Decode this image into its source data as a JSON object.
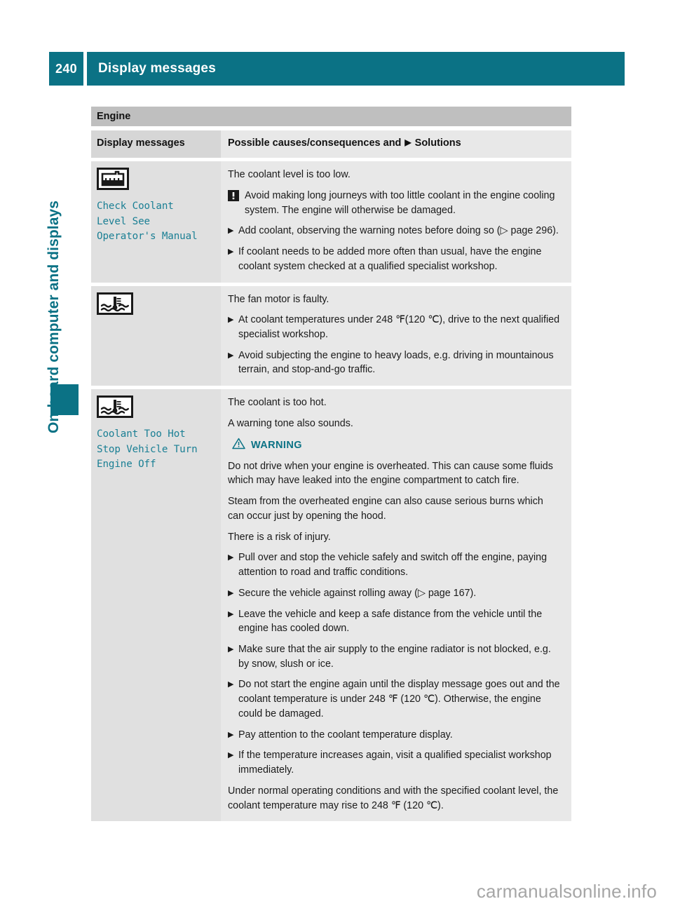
{
  "header": {
    "page_number": "240",
    "title": "Display messages"
  },
  "sidebar": {
    "vertical_label": "On-board computer and displays"
  },
  "table": {
    "section_title": "Engine",
    "columns": {
      "left_header": "Display messages",
      "right_header_pre": "Possible causes/consequences and",
      "right_header_bullet": "▶",
      "right_header_post": "Solutions"
    },
    "rows": [
      {
        "icon_name": "coolant-level-low-icon",
        "message": "Check Coolant\nLevel See\nOperator's Manual",
        "content": [
          {
            "type": "para",
            "text": "The coolant level is too low."
          },
          {
            "type": "note",
            "text": "Avoid making long journeys with too little coolant in the engine cooling system. The engine will otherwise be damaged."
          },
          {
            "type": "bullet",
            "text": "Add coolant, observing the warning notes before doing so (▷ page 296)."
          },
          {
            "type": "bullet",
            "text": "If coolant needs to be added more often than usual, have the engine coolant system checked at a qualified specialist workshop."
          }
        ]
      },
      {
        "icon_name": "coolant-temperature-icon",
        "message": "",
        "content": [
          {
            "type": "para",
            "text": "The fan motor is faulty."
          },
          {
            "type": "bullet",
            "text": "At coolant temperatures under 248 ℉(120 ℃), drive to the next qualified specialist workshop."
          },
          {
            "type": "bullet",
            "text": "Avoid subjecting the engine to heavy loads, e.g. driving in mountainous terrain, and stop-and-go traffic."
          }
        ]
      },
      {
        "icon_name": "coolant-temperature-icon",
        "message": "Coolant Too Hot\nStop Vehicle Turn\nEngine Off",
        "content": [
          {
            "type": "para",
            "text": "The coolant is too hot."
          },
          {
            "type": "para",
            "text": "A warning tone also sounds."
          },
          {
            "type": "warning_head",
            "text": "WARNING"
          },
          {
            "type": "para",
            "text": "Do not drive when your engine is overheated. This can cause some fluids which may have leaked into the engine compartment to catch fire."
          },
          {
            "type": "para",
            "text": "Steam from the overheated engine can also cause serious burns which can occur just by opening the hood."
          },
          {
            "type": "para",
            "text": "There is a risk of injury."
          },
          {
            "type": "bullet",
            "text": "Pull over and stop the vehicle safely and switch off the engine, paying attention to road and traffic conditions."
          },
          {
            "type": "bullet",
            "text": "Secure the vehicle against rolling away (▷ page 167)."
          },
          {
            "type": "bullet",
            "text": "Leave the vehicle and keep a safe distance from the vehicle until the engine has cooled down."
          },
          {
            "type": "bullet",
            "text": "Make sure that the air supply to the engine radiator is not blocked, e.g. by snow, slush or ice."
          },
          {
            "type": "bullet",
            "text": "Do not start the engine again until the display message goes out and the coolant temperature is under 248 ℉ (120 ℃). Otherwise, the engine could be damaged."
          },
          {
            "type": "bullet",
            "text": "Pay attention to the coolant temperature display."
          },
          {
            "type": "bullet",
            "text": "If the temperature increases again, visit a qualified specialist workshop immediately."
          },
          {
            "type": "para",
            "text": "Under normal operating conditions and with the specified coolant level, the coolant temperature may rise to 248 ℉ (120 ℃)."
          }
        ]
      }
    ]
  },
  "watermark": "carmanualsonline.info",
  "colors": {
    "teal": "#0b7285",
    "message_teal": "#1a7f94",
    "section_header_gray": "#bfbfbf",
    "left_column_gray": "#d6d6d6",
    "right_column_gray": "#e8e8e8"
  }
}
